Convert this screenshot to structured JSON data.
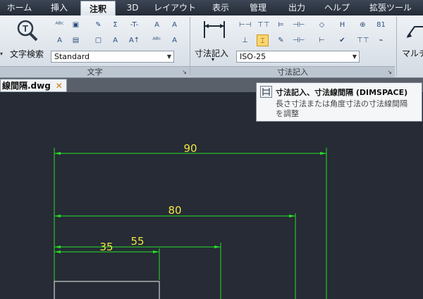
{
  "ribbon_tabs": [
    "ホーム",
    "挿入",
    "注釈",
    "3D",
    "レイアウト",
    "表示",
    "管理",
    "出力",
    "ヘルプ",
    "拡張ツール"
  ],
  "active_tab": "注釈",
  "text_panel": {
    "title": "文字",
    "find_text_label": "文字検索",
    "text_style_value": "Standard"
  },
  "dimension_panel": {
    "title": "寸法記入",
    "dimension_button_label": "寸法記入",
    "dim_style_value": "ISO-25"
  },
  "multileader_label": "マルチ",
  "document_tab": {
    "name": "線間隔.dwg",
    "close_glyph": "✕"
  },
  "tooltip": {
    "title": "寸法記入、寸法線間隔 (DIMSPACE)",
    "description": "長さ寸法または角度寸法の寸法線間隔を調整"
  },
  "drawing": {
    "dimension_values": [
      "90",
      "80",
      "55",
      "35"
    ],
    "dimension_color": "#26e026",
    "text_color": "#f0e640"
  },
  "icons": [
    "find-text-icon",
    "spell-check-icon",
    "text-style-icon",
    "dimension-icon",
    "dim-space-icon",
    "dim-break-icon",
    "multileader-icon",
    "close-icon"
  ]
}
